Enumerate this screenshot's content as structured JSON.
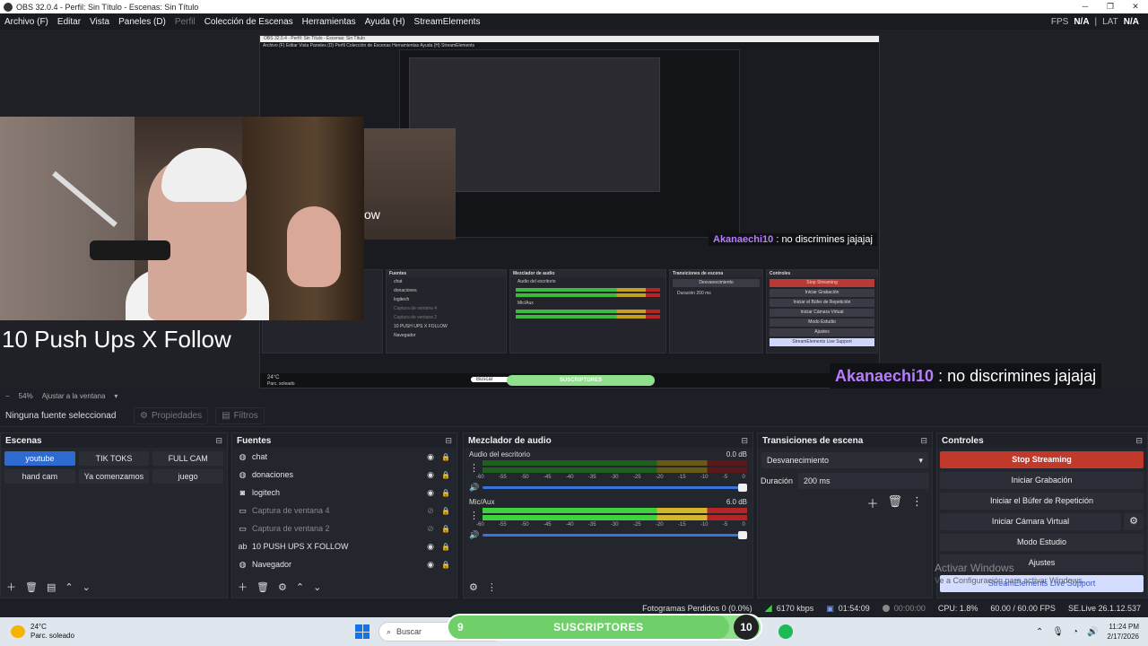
{
  "window": {
    "title": "OBS 32.0.4 - Perfil: Sin Título - Escenas: Sin Título",
    "minimize": "─",
    "maximize": "❐",
    "close": "✕"
  },
  "menu": {
    "items": [
      "Archivo (F)",
      "Editar",
      "Vista",
      "Paneles (D)",
      "Perfil",
      "Colección de Escenas",
      "Herramientas",
      "Ayuda (H)",
      "StreamElements"
    ],
    "disabled_index": 4,
    "fps_label": "FPS",
    "fps_value": "N/A",
    "lat_label": "LAT",
    "lat_value": "N/A"
  },
  "preview": {
    "follow_text": "10 Push Ups X Follow",
    "follow_text_small": "ow",
    "chat_user": "Akanaechi10",
    "chat_message": ": no discrimines jajajaj",
    "nested": {
      "title": "OBS 32.0.4 - Perfil: Sin Título - Escenas: Sin Título",
      "menu": "Archivo (F)   Editar   Vista   Paneles (D)   Perfil   Colección de Escenas   Herramientas   Ayuda (H)   StreamElements",
      "chat_user": "Akanaechi10",
      "chat_message": ": no discrimines jajajaj",
      "panels": {
        "sources_title": "Fuentes",
        "sources": [
          "chat",
          "donaciones",
          "logitech",
          "Captura de ventana 4",
          "Captura de ventana 2",
          "10 PUSH UPS X FOLLOW",
          "Navegador"
        ],
        "mixer_title": "Mezclador de audio",
        "mixer_channels": [
          "Audio del escritorio",
          "Mic/Aux"
        ],
        "transitions_title": "Transiciones de escena",
        "transition": "Desvanecimiento",
        "duration": "Duración",
        "duration_value": "200 ms",
        "controls_title": "Controles",
        "controls": [
          "Stop Streaming",
          "Iniciar Grabación",
          "Iniciar el Búfer de Repetición",
          "Iniciar Cámara Virtual",
          "Modo Estudio",
          "Ajustes",
          "StreamElements Live Support"
        ]
      },
      "taskbar": {
        "temp": "24°C",
        "weather": "Parc. soleado",
        "search": "Buscar",
        "sub_label": "SUSCRIPTORES"
      }
    }
  },
  "zoom": {
    "minus": "−",
    "level": "54%",
    "fit": "Ajustar a la ventana"
  },
  "sourcebar": {
    "no_source": "Ninguna fuente seleccionad",
    "properties": "Propiedades",
    "filters": "Filtros"
  },
  "scenes": {
    "title": "Escenas",
    "items": [
      "youtube",
      "TIK TOKS",
      "FULL CAM",
      "hand cam",
      "Ya comenzamos",
      "juego"
    ],
    "active_index": 0
  },
  "sources": {
    "title": "Fuentes",
    "items": [
      {
        "name": "chat",
        "icon": "globe-icon",
        "visible": true,
        "dim": false
      },
      {
        "name": "donaciones",
        "icon": "globe-icon",
        "visible": true,
        "dim": false
      },
      {
        "name": "logitech",
        "icon": "camera-icon",
        "visible": true,
        "dim": false
      },
      {
        "name": "Captura de ventana 4",
        "icon": "window-icon",
        "visible": false,
        "dim": true
      },
      {
        "name": "Captura de ventana 2",
        "icon": "window-icon",
        "visible": false,
        "dim": true
      },
      {
        "name": "10 PUSH UPS X FOLLOW",
        "icon": "text-icon",
        "visible": true,
        "dim": false
      },
      {
        "name": "Navegador",
        "icon": "globe-icon",
        "visible": true,
        "dim": false
      }
    ]
  },
  "mixer": {
    "title": "Mezclador de audio",
    "channels": [
      {
        "name": "Audio del escritorio",
        "db": "0.0 dB",
        "active": false
      },
      {
        "name": "Mic/Aux",
        "db": "6.0 dB",
        "active": true
      }
    ],
    "ticks": [
      "-60",
      "-55",
      "-50",
      "-45",
      "-40",
      "-35",
      "-30",
      "-25",
      "-20",
      "-15",
      "-10",
      "-5",
      "0"
    ]
  },
  "transitions": {
    "title": "Transiciones de escena",
    "selected": "Desvanecimiento",
    "duration_label": "Duración",
    "duration_value": "200 ms"
  },
  "controls": {
    "title": "Controles",
    "stop_streaming": "Stop Streaming",
    "start_recording": "Iniciar Grabación",
    "replay_buffer": "Iniciar el Búfer de Repetición",
    "virtual_camera": "Iniciar Cámara Virtual",
    "studio_mode": "Modo Estudio",
    "settings": "Ajustes",
    "live_support": "StreamElements Live Support"
  },
  "watermark": {
    "line1": "Activar Windows",
    "line2": "Ve a Configuración para activar Windows."
  },
  "status": {
    "dropped": "Fotogramas Perdidos 0 (0.0%)",
    "bitrate": "6170 kbps",
    "stream_time": "01:54:09",
    "rec_time": "00:00:00",
    "cpu": "CPU: 1.8%",
    "fps": "60.00 / 60.00 FPS",
    "version": "SE.Live 26.1.12.537"
  },
  "taskbar": {
    "temp": "24°C",
    "weather": "Parc. soleado",
    "search": "Buscar",
    "sub_count": "9",
    "sub_label": "SUSCRIPTORES",
    "sub_goal": "10",
    "sub_progress": 0.9,
    "time": "11:24 PM",
    "date": "2/17/2026"
  }
}
